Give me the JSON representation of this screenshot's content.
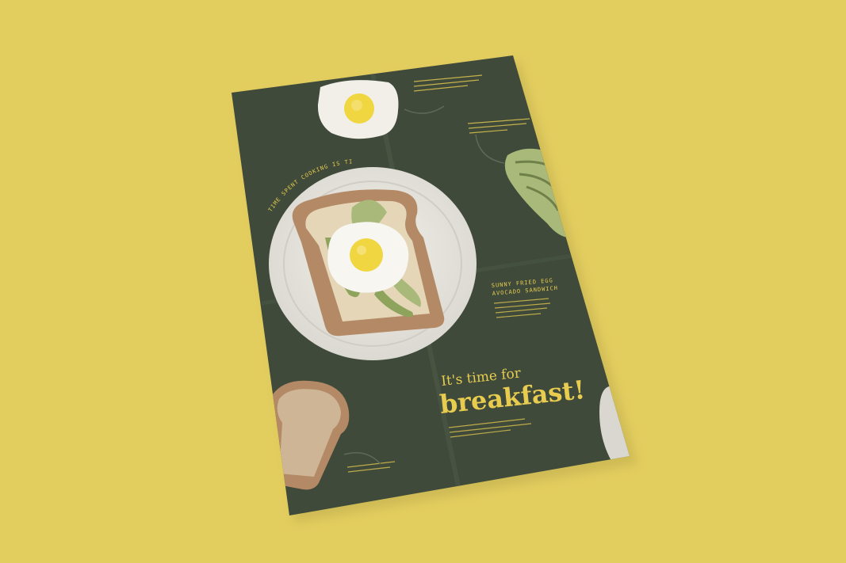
{
  "colors": {
    "background": "#e2cd5f",
    "poster": "#3f4a3a",
    "accent_yellow": "#e7cc50",
    "plate": "#e7e5dd",
    "toast_crust": "#b48a66",
    "toast_crumb": "#e6d6b8",
    "avocado": "#a9b979",
    "egg_yolk": "#f0d640"
  },
  "poster": {
    "arc_text": "TIME SPENT COOKING IS TIME WELL SPENT.",
    "item_title_line1": "SUNNY FRIED EGG",
    "item_title_line2": "AVOCADO SANDWICH",
    "headline_small": "It's time for",
    "headline_big": "breakfast!"
  },
  "icons": [
    "fried-egg-icon",
    "toast-with-egg-and-avocado-icon",
    "bread-slice-icon",
    "avocado-icon"
  ]
}
